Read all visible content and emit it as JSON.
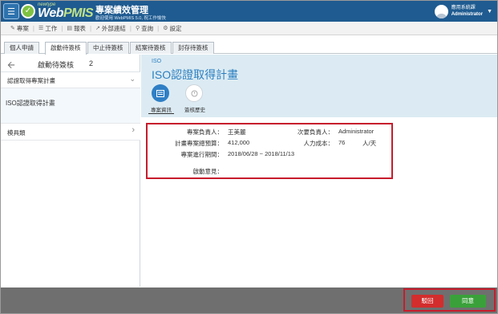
{
  "header": {
    "brand_sub": "newtype",
    "brand_web": "Web",
    "brand_pmis": "PMIS",
    "system_title": "專案績效管理",
    "system_subtitle": "歡迎使用 WebPMIS 5.0, 祝工作愉快",
    "user_name": "應用系統課",
    "user_role": "Administrator"
  },
  "menu": {
    "items": [
      {
        "label": "專案",
        "icon": "edit-icon"
      },
      {
        "label": "工作",
        "icon": "list-icon"
      },
      {
        "label": "報表",
        "icon": "report-icon"
      },
      {
        "label": "外部連結",
        "icon": "link-icon"
      },
      {
        "label": "查詢",
        "icon": "search-icon"
      },
      {
        "label": "設定",
        "icon": "gear-icon"
      }
    ]
  },
  "tabs": [
    {
      "label": "個人申請"
    },
    {
      "label": "啟動待簽核"
    },
    {
      "label": "中止待簽核"
    },
    {
      "label": "結案待簽核"
    },
    {
      "label": "封存待簽核"
    }
  ],
  "left": {
    "title": "啟動待簽核",
    "count": "2",
    "group1": "認證取得專案計畫",
    "item1": "ISO認證取得計畫",
    "group2": "模具類"
  },
  "project": {
    "category": "ISO",
    "title": "ISO認證取得計畫",
    "tab_info": "專案資訊",
    "tab_history": "簽核歷史"
  },
  "fields": {
    "manager_label": "專案負責人：",
    "manager_value": "王美麗",
    "secondary_label": "次要負責人：",
    "secondary_value": "Administrator",
    "budget_label": "計畫專案總預算：",
    "budget_value": "412,000",
    "manpower_label": "人力成本：",
    "manpower_value": "76",
    "manpower_unit": "人/天",
    "period_label": "專案進行期間：",
    "period_value": "2018/06/28 ~ 2018/11/13",
    "opinion_label": "啟動意見："
  },
  "footer": {
    "reject_label": "駁回",
    "approve_label": "同意"
  },
  "colors": {
    "header_bg": "#1f5b90",
    "accent": "#2b7fc0",
    "highlight_border": "#c71c2c",
    "reject": "#d32d2d",
    "approve": "#3aa13a"
  }
}
